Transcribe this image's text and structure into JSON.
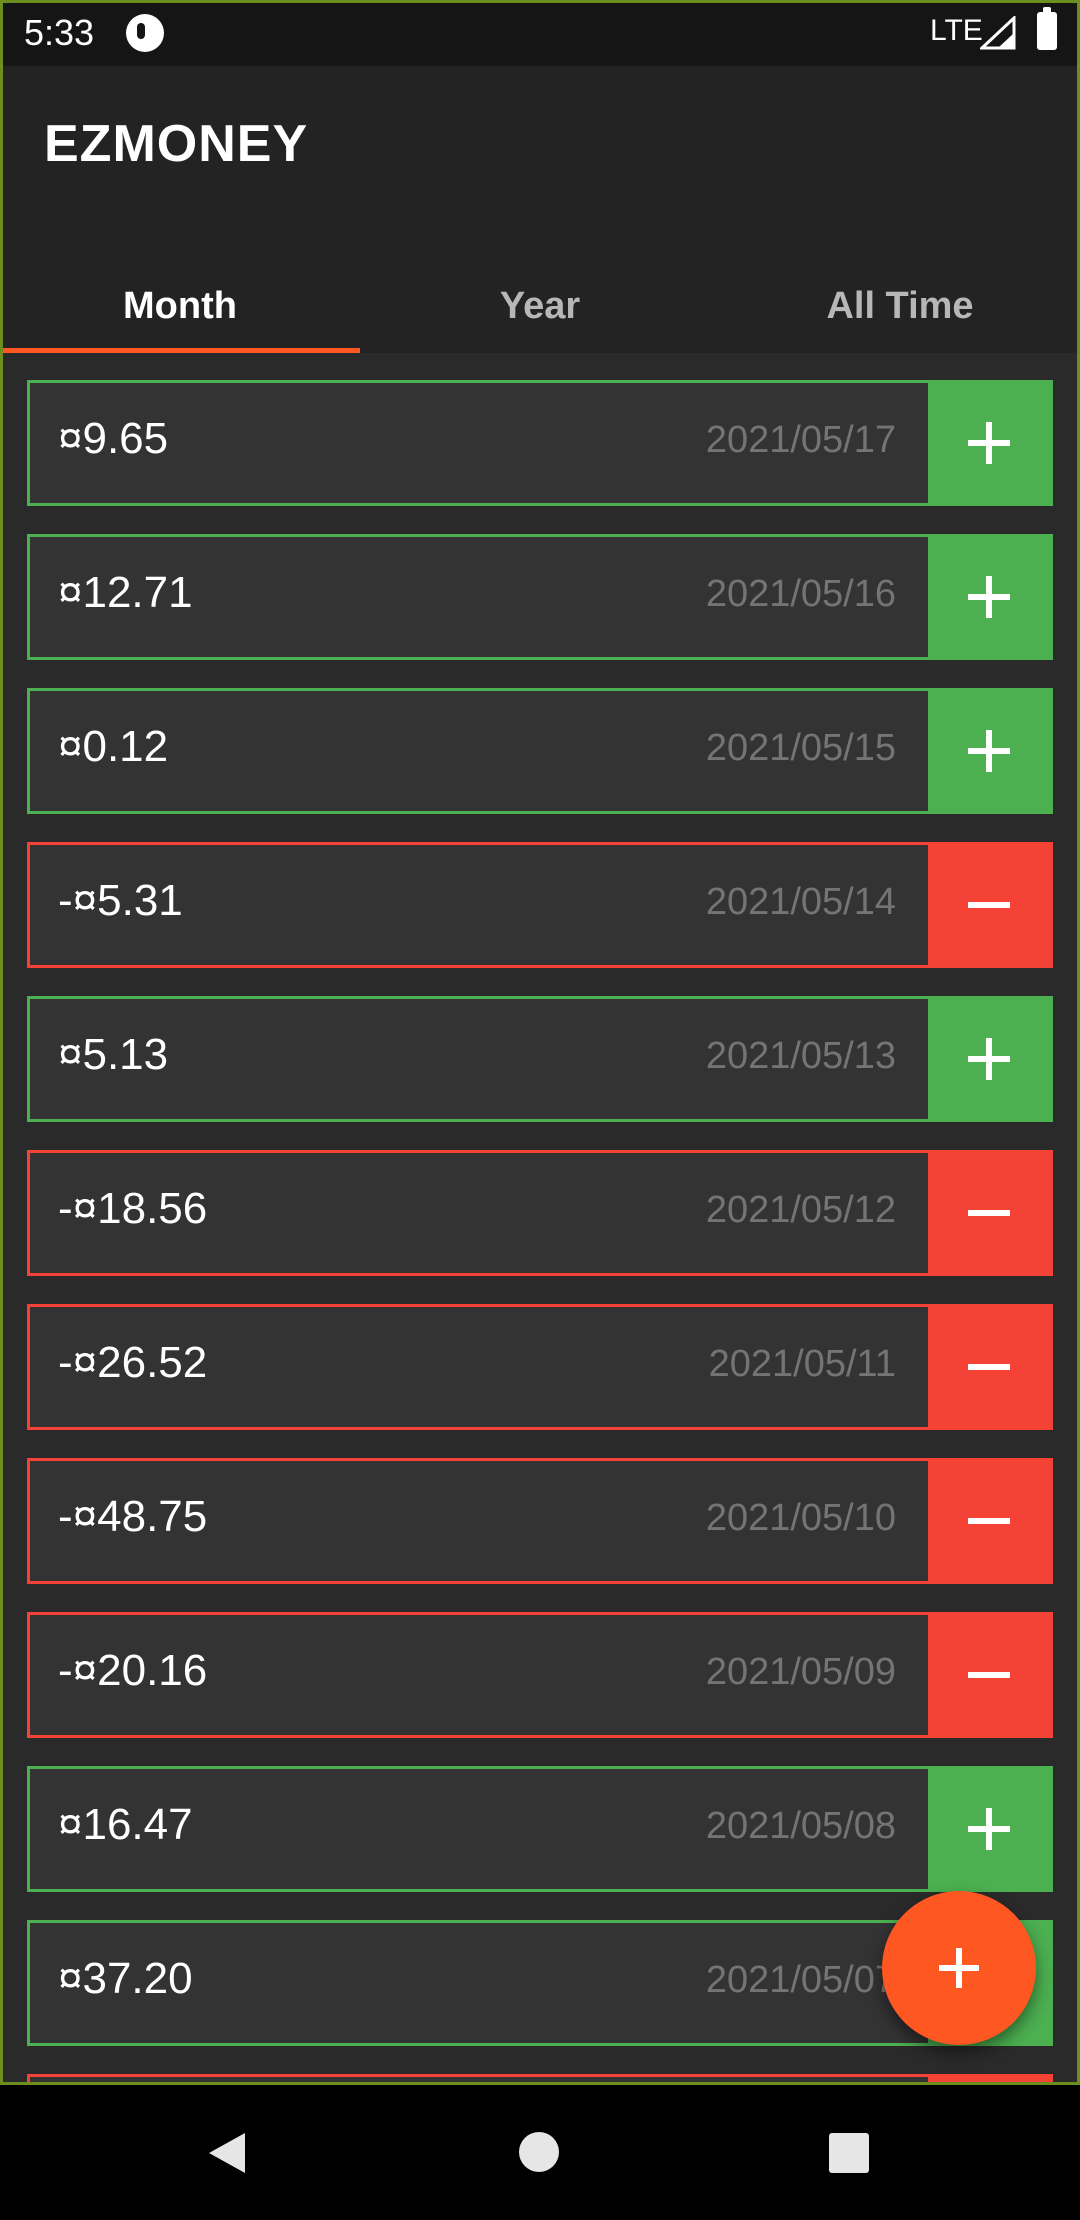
{
  "status_bar": {
    "time": "5:33",
    "network": "LTE"
  },
  "app": {
    "title": "EZMONEY"
  },
  "tabs": [
    {
      "label": "Month",
      "active": true
    },
    {
      "label": "Year",
      "active": false
    },
    {
      "label": "All Time",
      "active": false
    }
  ],
  "transactions": [
    {
      "amount": "¤9.65",
      "date": "2021/05/17",
      "type": "income",
      "button_icon": "plus-icon"
    },
    {
      "amount": "¤12.71",
      "date": "2021/05/16",
      "type": "income",
      "button_icon": "plus-icon"
    },
    {
      "amount": "¤0.12",
      "date": "2021/05/15",
      "type": "income",
      "button_icon": "plus-icon"
    },
    {
      "amount": "-¤5.31",
      "date": "2021/05/14",
      "type": "expense",
      "button_icon": "minus-icon"
    },
    {
      "amount": "¤5.13",
      "date": "2021/05/13",
      "type": "income",
      "button_icon": "plus-icon"
    },
    {
      "amount": "-¤18.56",
      "date": "2021/05/12",
      "type": "expense",
      "button_icon": "minus-icon"
    },
    {
      "amount": "-¤26.52",
      "date": "2021/05/11",
      "type": "expense",
      "button_icon": "minus-icon"
    },
    {
      "amount": "-¤48.75",
      "date": "2021/05/10",
      "type": "expense",
      "button_icon": "minus-icon"
    },
    {
      "amount": "-¤20.16",
      "date": "2021/05/09",
      "type": "expense",
      "button_icon": "minus-icon"
    },
    {
      "amount": "¤16.47",
      "date": "2021/05/08",
      "type": "income",
      "button_icon": "plus-icon"
    },
    {
      "amount": "¤37.20",
      "date": "2021/05/07",
      "type": "income",
      "button_icon": "plus-icon"
    }
  ],
  "fab": {
    "icon": "plus-icon"
  },
  "colors": {
    "income": "#4caf50",
    "expense": "#f44336",
    "accent": "#ff5722",
    "app_bar": "#232323",
    "card": "#333333"
  },
  "nav_bar": {
    "icons": [
      "back-icon",
      "home-icon",
      "recents-icon"
    ]
  }
}
